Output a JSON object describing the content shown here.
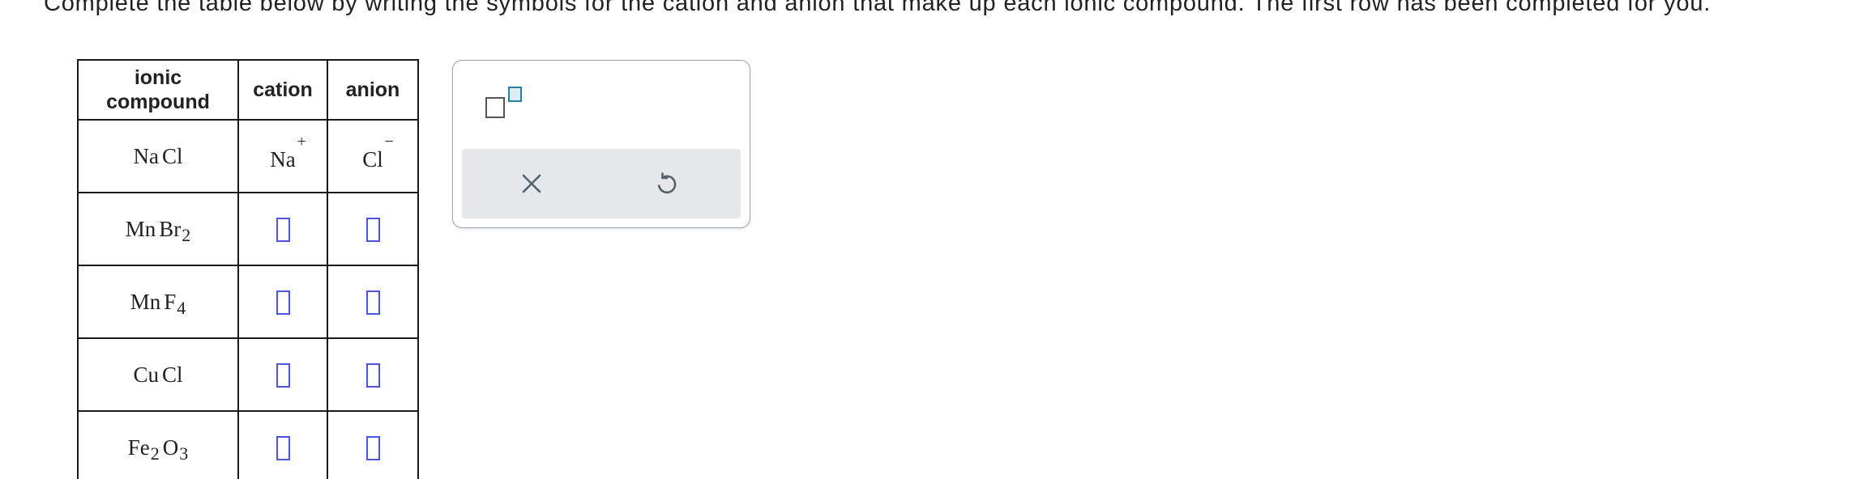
{
  "instruction": "Complete the table below by writing the symbols for the cation and anion that make up each ionic compound. The first row has been completed for you.",
  "table": {
    "headers": {
      "compound_line1": "ionic",
      "compound_line2": "compound",
      "cation": "cation",
      "anion": "anion"
    },
    "rows": [
      {
        "compound": [
          {
            "el": "Na",
            "sub": ""
          },
          {
            "el": "Cl",
            "sub": ""
          }
        ],
        "cation": {
          "symbol": "Na",
          "charge": "+"
        },
        "anion": {
          "symbol": "Cl",
          "charge": "−"
        }
      },
      {
        "compound": [
          {
            "el": "Mn",
            "sub": ""
          },
          {
            "el": "Br",
            "sub": "2"
          }
        ],
        "cation": null,
        "anion": null
      },
      {
        "compound": [
          {
            "el": "Mn",
            "sub": ""
          },
          {
            "el": "F",
            "sub": "4"
          }
        ],
        "cation": null,
        "anion": null
      },
      {
        "compound": [
          {
            "el": "Cu",
            "sub": ""
          },
          {
            "el": "Cl",
            "sub": ""
          }
        ],
        "cation": null,
        "anion": null
      },
      {
        "compound": [
          {
            "el": "Fe",
            "sub": "2"
          },
          {
            "el": "O",
            "sub": "3"
          }
        ],
        "cation": null,
        "anion": null
      }
    ]
  },
  "palette": {
    "tools": [
      {
        "icon": "superscript-template-icon"
      }
    ],
    "actions": [
      {
        "icon": "close-icon"
      },
      {
        "icon": "undo-icon"
      }
    ]
  },
  "colors": {
    "answer_box_border": "#4a56e0",
    "superscript_accent": "#2a7ea7",
    "action_bar_bg": "#e4e8ea",
    "icon_color": "#56616b"
  }
}
